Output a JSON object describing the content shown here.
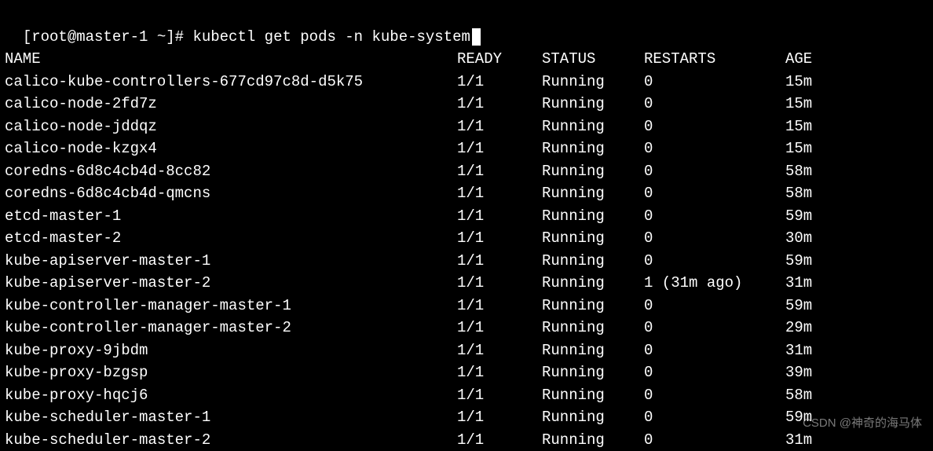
{
  "prompt": {
    "user_host": "[root@master-1 ~]# ",
    "command": "kubectl get pods -n kube-system"
  },
  "table": {
    "headers": {
      "name": "NAME",
      "ready": "READY",
      "status": "STATUS",
      "restarts": "RESTARTS",
      "age": "AGE"
    },
    "rows": [
      {
        "name": "calico-kube-controllers-677cd97c8d-d5k75",
        "ready": "1/1",
        "status": "Running",
        "restarts": "0",
        "age": "15m"
      },
      {
        "name": "calico-node-2fd7z",
        "ready": "1/1",
        "status": "Running",
        "restarts": "0",
        "age": "15m"
      },
      {
        "name": "calico-node-jddqz",
        "ready": "1/1",
        "status": "Running",
        "restarts": "0",
        "age": "15m"
      },
      {
        "name": "calico-node-kzgx4",
        "ready": "1/1",
        "status": "Running",
        "restarts": "0",
        "age": "15m"
      },
      {
        "name": "coredns-6d8c4cb4d-8cc82",
        "ready": "1/1",
        "status": "Running",
        "restarts": "0",
        "age": "58m"
      },
      {
        "name": "coredns-6d8c4cb4d-qmcns",
        "ready": "1/1",
        "status": "Running",
        "restarts": "0",
        "age": "58m"
      },
      {
        "name": "etcd-master-1",
        "ready": "1/1",
        "status": "Running",
        "restarts": "0",
        "age": "59m"
      },
      {
        "name": "etcd-master-2",
        "ready": "1/1",
        "status": "Running",
        "restarts": "0",
        "age": "30m"
      },
      {
        "name": "kube-apiserver-master-1",
        "ready": "1/1",
        "status": "Running",
        "restarts": "0",
        "age": "59m"
      },
      {
        "name": "kube-apiserver-master-2",
        "ready": "1/1",
        "status": "Running",
        "restarts": "1 (31m ago)",
        "age": "31m"
      },
      {
        "name": "kube-controller-manager-master-1",
        "ready": "1/1",
        "status": "Running",
        "restarts": "0",
        "age": "59m"
      },
      {
        "name": "kube-controller-manager-master-2",
        "ready": "1/1",
        "status": "Running",
        "restarts": "0",
        "age": "29m"
      },
      {
        "name": "kube-proxy-9jbdm",
        "ready": "1/1",
        "status": "Running",
        "restarts": "0",
        "age": "31m"
      },
      {
        "name": "kube-proxy-bzgsp",
        "ready": "1/1",
        "status": "Running",
        "restarts": "0",
        "age": "39m"
      },
      {
        "name": "kube-proxy-hqcj6",
        "ready": "1/1",
        "status": "Running",
        "restarts": "0",
        "age": "58m"
      },
      {
        "name": "kube-scheduler-master-1",
        "ready": "1/1",
        "status": "Running",
        "restarts": "0",
        "age": "59m"
      },
      {
        "name": "kube-scheduler-master-2",
        "ready": "1/1",
        "status": "Running",
        "restarts": "0",
        "age": "31m"
      }
    ]
  },
  "watermark": "CSDN @神奇的海马体"
}
